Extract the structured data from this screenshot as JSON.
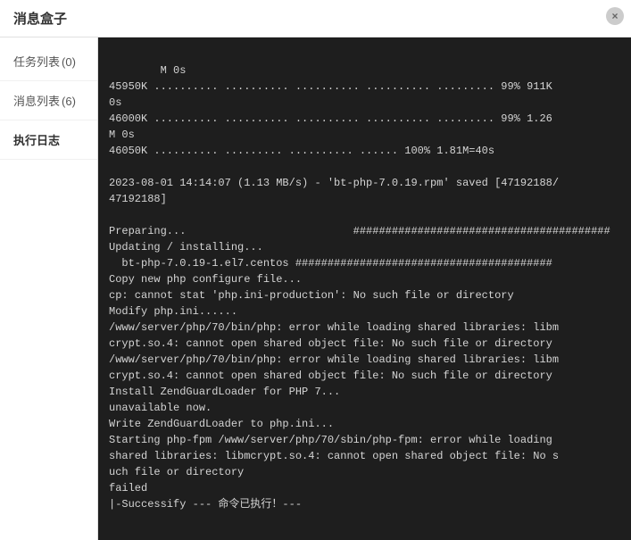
{
  "title": "消息盒子",
  "close_icon": "×",
  "sidebar": {
    "items": [
      {
        "label": "任务列表",
        "badge": "(0)",
        "id": "tasks"
      },
      {
        "label": "消息列表",
        "badge": "(6)",
        "id": "messages"
      },
      {
        "label": "执行日志",
        "badge": "",
        "id": "logs",
        "active": true
      }
    ]
  },
  "log": {
    "content": "M 0s\n45950K .......... .......... .......... .......... ......... 99% 911K\n0s\n46000K .......... .......... .......... .......... ......... 99% 1.26\nM 0s\n46050K .......... ......... .......... ...... 100% 1.81M=40s\n\n2023-08-01 14:14:07 (1.13 MB/s) - 'bt-php-7.0.19.rpm' saved [47192188/\n47192188]\n\nPreparing...                          ########################################\nUpdating / installing...\n  bt-php-7.0.19-1.el7.centos ########################################\nCopy new php configure file...\ncp: cannot stat 'php.ini-production': No such file or directory\nModify php.ini......\n/www/server/php/70/bin/php: error while loading shared libraries: libm\ncrypt.so.4: cannot open shared object file: No such file or directory\n/www/server/php/70/bin/php: error while loading shared libraries: libm\ncrypt.so.4: cannot open shared object file: No such file or directory\nInstall ZendGuardLoader for PHP 7...\nunavailable now.\nWrite ZendGuardLoader to php.ini...\nStarting php-fpm /www/server/php/70/sbin/php-fpm: error while loading\nshared libraries: libmcrypt.so.4: cannot open shared object file: No s\nuch file or directory\nfailed\n|-Successify --- 命令已执行！---"
  }
}
